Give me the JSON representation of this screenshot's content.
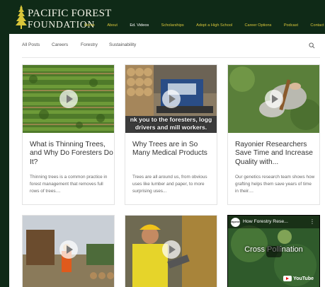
{
  "brand": {
    "line1": "PACIFIC FOREST",
    "line2": "FOUNDATION",
    "colors": {
      "header_bg": "#0f2a17",
      "nav_link": "#d9c63a",
      "nav_active": "#ffffff"
    }
  },
  "nav": {
    "items": [
      "Home",
      "About",
      "Ed. Videos",
      "Scholarships",
      "Adopt a High School",
      "Career Options",
      "Podcast",
      "Contact"
    ],
    "active": "Ed. Videos"
  },
  "categories": {
    "items": [
      "All Posts",
      "Careers",
      "Forestry",
      "Sustainability"
    ],
    "search_icon": "search-icon"
  },
  "posts": [
    {
      "title": "What is Thinning Trees, and Why Do Foresters Do It?",
      "excerpt": "Thinning trees is a common practice in forest management that removes full rows of trees...."
    },
    {
      "title": "Why Trees are in So Many Medical Products",
      "excerpt": "Trees are all around us, from obvious uses like lumber and paper, to more surprising uses...",
      "overlay_line1": "nk you to the foresters, logg",
      "overlay_line2": "drivers and mill workers."
    },
    {
      "title": "Rayonier Researchers Save Time and Increase Quality with...",
      "excerpt": "Our genetics research team shows how grafting helps them save years of time in their...."
    }
  ],
  "videos": [
    {
      "label": ""
    },
    {
      "label": ""
    },
    {
      "channel": "rayonier",
      "title": "How Forestry Rese...",
      "center_text": "Cross Pollination",
      "provider": "YouTube"
    }
  ]
}
